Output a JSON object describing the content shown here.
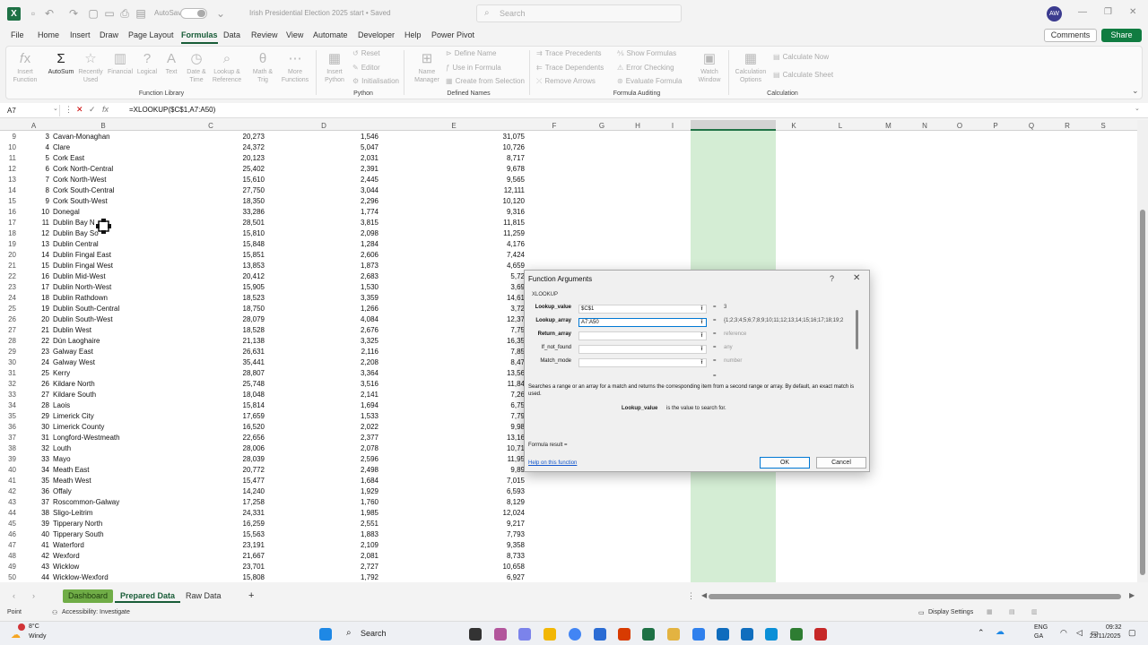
{
  "title_bar": {
    "autosave_label": "AutoSave",
    "autosave_state": "Off",
    "doc_title": "Irish Presidential Election 2025 start • Saved",
    "search_placeholder": "Search",
    "avatar": "AW",
    "accent": "#1e7145"
  },
  "menu": {
    "tabs": [
      "File",
      "Home",
      "Insert",
      "Draw",
      "Page Layout",
      "Formulas",
      "Data",
      "Review",
      "View",
      "Automate",
      "Developer",
      "Help",
      "Power Pivot"
    ],
    "active": "Formulas",
    "comments": "Comments",
    "share": "Share"
  },
  "ribbon": {
    "insert_function": "Insert\nFunction",
    "autosum": "AutoSum",
    "recently_used": "Recently\nUsed",
    "financial": "Financial",
    "logical": "Logical",
    "text": "Text",
    "date_time": "Date &\nTime",
    "lookup_reference": "Lookup &\nReference",
    "math_trig": "Math &\nTrig",
    "more_functions": "More\nFunctions",
    "function_library": "Function Library",
    "insert_python": "Insert\nPython",
    "reset": "Reset",
    "editor": "Editor",
    "initialisation": "Initialisation",
    "python": "Python",
    "name_manager": "Name\nManager",
    "define_name": "Define Name",
    "use_in_formula": "Use in Formula",
    "create_from_selection": "Create from Selection",
    "defined_names": "Defined Names",
    "trace_precedents": "Trace Precedents",
    "trace_dependents": "Trace Dependents",
    "remove_arrows": "Remove Arrows",
    "show_formulas": "Show Formulas",
    "error_checking": "Error Checking",
    "evaluate_formula": "Evaluate Formula",
    "watch_window": "Watch\nWindow",
    "formula_auditing": "Formula Auditing",
    "calculation_options": "Calculation\nOptions",
    "calculate_now": "Calculate Now",
    "calculate_sheet": "Calculate Sheet",
    "calculation": "Calculation"
  },
  "formula_bar": {
    "name_box": "A7",
    "formula": "=XLOOKUP($C$1,A7:A50)"
  },
  "columns": [
    "A",
    "B",
    "C",
    "D",
    "E",
    "F",
    "G",
    "H",
    "I",
    "J",
    "K",
    "L",
    "M",
    "N",
    "O",
    "P",
    "Q",
    "R",
    "S"
  ],
  "rows": [
    {
      "r": "9",
      "a": "3",
      "b": "Cavan-Monaghan",
      "c": "20,273",
      "d": "1,546",
      "e": "31,075"
    },
    {
      "r": "10",
      "a": "4",
      "b": "Clare",
      "c": "24,372",
      "d": "5,047",
      "e": "10,726"
    },
    {
      "r": "11",
      "a": "5",
      "b": "Cork East",
      "c": "20,123",
      "d": "2,031",
      "e": "8,717"
    },
    {
      "r": "12",
      "a": "6",
      "b": "Cork North-Central",
      "c": "25,402",
      "d": "2,391",
      "e": "9,678"
    },
    {
      "r": "13",
      "a": "7",
      "b": "Cork North-West",
      "c": "15,610",
      "d": "2,445",
      "e": "9,565"
    },
    {
      "r": "14",
      "a": "8",
      "b": "Cork South-Central",
      "c": "27,750",
      "d": "3,044",
      "e": "12,111"
    },
    {
      "r": "15",
      "a": "9",
      "b": "Cork South-West",
      "c": "18,350",
      "d": "2,296",
      "e": "10,120"
    },
    {
      "r": "16",
      "a": "10",
      "b": "Donegal",
      "c": "33,286",
      "d": "1,774",
      "e": "9,316"
    },
    {
      "r": "17",
      "a": "11",
      "b": "Dublin Bay N",
      "c": "28,501",
      "d": "3,815",
      "e": "11,815"
    },
    {
      "r": "18",
      "a": "12",
      "b": "Dublin Bay So",
      "c": "15,810",
      "d": "2,098",
      "e": "11,259"
    },
    {
      "r": "19",
      "a": "13",
      "b": "Dublin Central",
      "c": "15,848",
      "d": "1,284",
      "e": "4,176"
    },
    {
      "r": "20",
      "a": "14",
      "b": "Dublin Fingal East",
      "c": "15,851",
      "d": "2,606",
      "e": "7,424"
    },
    {
      "r": "21",
      "a": "15",
      "b": "Dublin Fingal West",
      "c": "13,853",
      "d": "1,873",
      "e": "4,659"
    },
    {
      "r": "22",
      "a": "16",
      "b": "Dublin Mid-West",
      "c": "20,412",
      "d": "2,683",
      "e": "5,72"
    },
    {
      "r": "23",
      "a": "17",
      "b": "Dublin North-West",
      "c": "15,905",
      "d": "1,530",
      "e": "3,69"
    },
    {
      "r": "24",
      "a": "18",
      "b": "Dublin Rathdown",
      "c": "18,523",
      "d": "3,359",
      "e": "14,61"
    },
    {
      "r": "25",
      "a": "19",
      "b": "Dublin South-Central",
      "c": "18,750",
      "d": "1,266",
      "e": "3,72"
    },
    {
      "r": "26",
      "a": "20",
      "b": "Dublin South-West",
      "c": "28,079",
      "d": "4,084",
      "e": "12,37"
    },
    {
      "r": "27",
      "a": "21",
      "b": "Dublin West",
      "c": "18,528",
      "d": "2,676",
      "e": "7,75"
    },
    {
      "r": "28",
      "a": "22",
      "b": "Dún Laoghaire",
      "c": "21,138",
      "d": "3,325",
      "e": "16,35"
    },
    {
      "r": "29",
      "a": "23",
      "b": "Galway East",
      "c": "26,631",
      "d": "2,116",
      "e": "7,85"
    },
    {
      "r": "30",
      "a": "24",
      "b": "Galway West",
      "c": "35,441",
      "d": "2,208",
      "e": "8,47"
    },
    {
      "r": "31",
      "a": "25",
      "b": "Kerry",
      "c": "28,807",
      "d": "3,364",
      "e": "13,56"
    },
    {
      "r": "32",
      "a": "26",
      "b": "Kildare North",
      "c": "25,748",
      "d": "3,516",
      "e": "11,84"
    },
    {
      "r": "33",
      "a": "27",
      "b": "Kildare South",
      "c": "18,048",
      "d": "2,141",
      "e": "7,26"
    },
    {
      "r": "34",
      "a": "28",
      "b": "Laois",
      "c": "15,814",
      "d": "1,694",
      "e": "6,75"
    },
    {
      "r": "35",
      "a": "29",
      "b": "Limerick City",
      "c": "17,659",
      "d": "1,533",
      "e": "7,79"
    },
    {
      "r": "36",
      "a": "30",
      "b": "Limerick County",
      "c": "16,520",
      "d": "2,022",
      "e": "9,98"
    },
    {
      "r": "37",
      "a": "31",
      "b": "Longford-Westmeath",
      "c": "22,656",
      "d": "2,377",
      "e": "13,16"
    },
    {
      "r": "38",
      "a": "32",
      "b": "Louth",
      "c": "28,006",
      "d": "2,078",
      "e": "10,71"
    },
    {
      "r": "39",
      "a": "33",
      "b": "Mayo",
      "c": "28,039",
      "d": "2,596",
      "e": "11,95"
    },
    {
      "r": "40",
      "a": "34",
      "b": "Meath East",
      "c": "20,772",
      "d": "2,498",
      "e": "9,89"
    },
    {
      "r": "41",
      "a": "35",
      "b": "Meath West",
      "c": "15,477",
      "d": "1,684",
      "e": "7,015"
    },
    {
      "r": "42",
      "a": "36",
      "b": "Offaly",
      "c": "14,240",
      "d": "1,929",
      "e": "6,593"
    },
    {
      "r": "43",
      "a": "37",
      "b": "Roscommon-Galway",
      "c": "17,258",
      "d": "1,760",
      "e": "8,129"
    },
    {
      "r": "44",
      "a": "38",
      "b": "Sligo-Leitrim",
      "c": "24,331",
      "d": "1,985",
      "e": "12,024"
    },
    {
      "r": "45",
      "a": "39",
      "b": "Tipperary North",
      "c": "16,259",
      "d": "2,551",
      "e": "9,217"
    },
    {
      "r": "46",
      "a": "40",
      "b": "Tipperary South",
      "c": "15,563",
      "d": "1,883",
      "e": "7,793"
    },
    {
      "r": "47",
      "a": "41",
      "b": "Waterford",
      "c": "23,191",
      "d": "2,109",
      "e": "9,358"
    },
    {
      "r": "48",
      "a": "42",
      "b": "Wexford",
      "c": "21,667",
      "d": "2,081",
      "e": "8,733"
    },
    {
      "r": "49",
      "a": "43",
      "b": "Wicklow",
      "c": "23,701",
      "d": "2,727",
      "e": "10,658"
    },
    {
      "r": "50",
      "a": "44",
      "b": "Wicklow-Wexford",
      "c": "15,808",
      "d": "1,792",
      "e": "6,927"
    }
  ],
  "sheets": {
    "dashboard": "Dashboard",
    "prepared": "Prepared Data",
    "raw": "Raw Data"
  },
  "status": {
    "mode": "Point",
    "accessibility": "Accessibility: Investigate",
    "display_settings": "Display Settings"
  },
  "taskbar": {
    "weather_temp": "8°C",
    "weather_desc": "Windy",
    "search": "Search",
    "lang1": "ENG",
    "lang2": "GA",
    "time": "09:32",
    "date": "23/11/2025"
  },
  "dialog": {
    "title": "Function Arguments",
    "function": "XLOOKUP",
    "args": [
      {
        "label": "Lookup_value",
        "value": "$C$1",
        "result": "3",
        "bold": true,
        "dim": false
      },
      {
        "label": "Lookup_array",
        "value": "A7:A50",
        "result": "{1;2;3;4;5;6;7;8;9;10;11;12;13;14;15;16;17;18;19;2",
        "bold": true,
        "dim": false
      },
      {
        "label": "Return_array",
        "value": "",
        "result": "reference",
        "bold": true,
        "dim": true
      },
      {
        "label": "If_not_found",
        "value": "",
        "result": "any",
        "bold": false,
        "dim": true
      },
      {
        "label": "Match_mode",
        "value": "",
        "result": "number",
        "bold": false,
        "dim": true
      }
    ],
    "description": "Searches a range or an array for a match and returns the corresponding item from a second range or array. By default, an exact match is used.",
    "arg_name": "Lookup_value",
    "arg_desc": "is the value to search for.",
    "formula_result": "Formula result =",
    "help": "Help on this function",
    "ok": "OK",
    "cancel": "Cancel"
  }
}
